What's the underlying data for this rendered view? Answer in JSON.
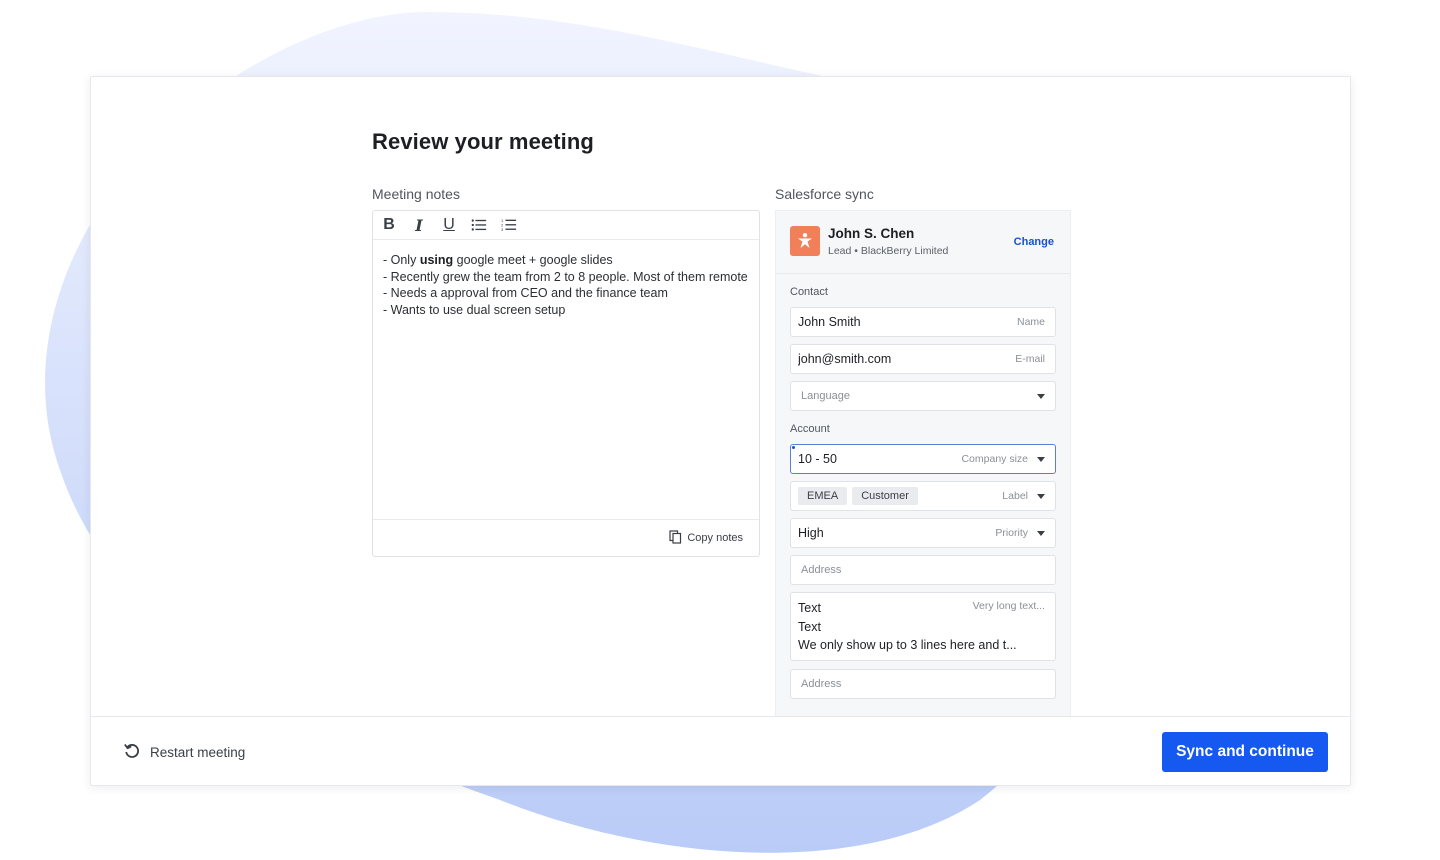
{
  "page": {
    "title": "Review your meeting"
  },
  "notes": {
    "section_label": "Meeting notes",
    "toolbar": {
      "bold": "B",
      "italic": "I",
      "underline": "U",
      "bullet_list_icon": "bulleted-list-icon",
      "numbered_list_icon": "numbered-list-icon"
    },
    "lines": [
      {
        "prefix": "- Only ",
        "bold": "using",
        "suffix": " google meet + google slides"
      },
      {
        "text": "- Recently grew the team from 2 to 8 people. Most of them remote"
      },
      {
        "text": "- Needs a approval from CEO and  the finance team"
      },
      {
        "text": "- Wants to use dual screen setup"
      }
    ],
    "copy_label": "Copy notes"
  },
  "salesforce": {
    "section_label": "Salesforce sync",
    "record": {
      "name": "John S. Chen",
      "subtitle": "Lead • BlackBerry Limited",
      "change_label": "Change",
      "avatar_color": "#f07f5a"
    },
    "contact": {
      "label": "Contact",
      "name": {
        "value": "John Smith",
        "hint": "Name"
      },
      "email": {
        "value": "john@smith.com",
        "hint": "E-mail"
      },
      "language": {
        "placeholder": "Language"
      }
    },
    "account": {
      "label": "Account",
      "company_size": {
        "value": "10 - 50",
        "hint": "Company size"
      },
      "labels": {
        "chips": [
          "EMEA",
          "Customer"
        ],
        "hint": "Label"
      },
      "priority": {
        "value": "High",
        "hint": "Priority"
      },
      "address_1": {
        "placeholder": "Address"
      },
      "long_text": {
        "lines": [
          "Text",
          "Text",
          "We only show up to 3 lines here and t..."
        ],
        "hint": "Very long text..."
      },
      "address_2": {
        "placeholder": "Address"
      }
    }
  },
  "footer": {
    "restart_label": "Restart meeting",
    "sync_label": "Sync and continue"
  },
  "colors": {
    "primary": "#1659f0",
    "link": "#1751d0",
    "background_blob": "#c9d6fb"
  }
}
